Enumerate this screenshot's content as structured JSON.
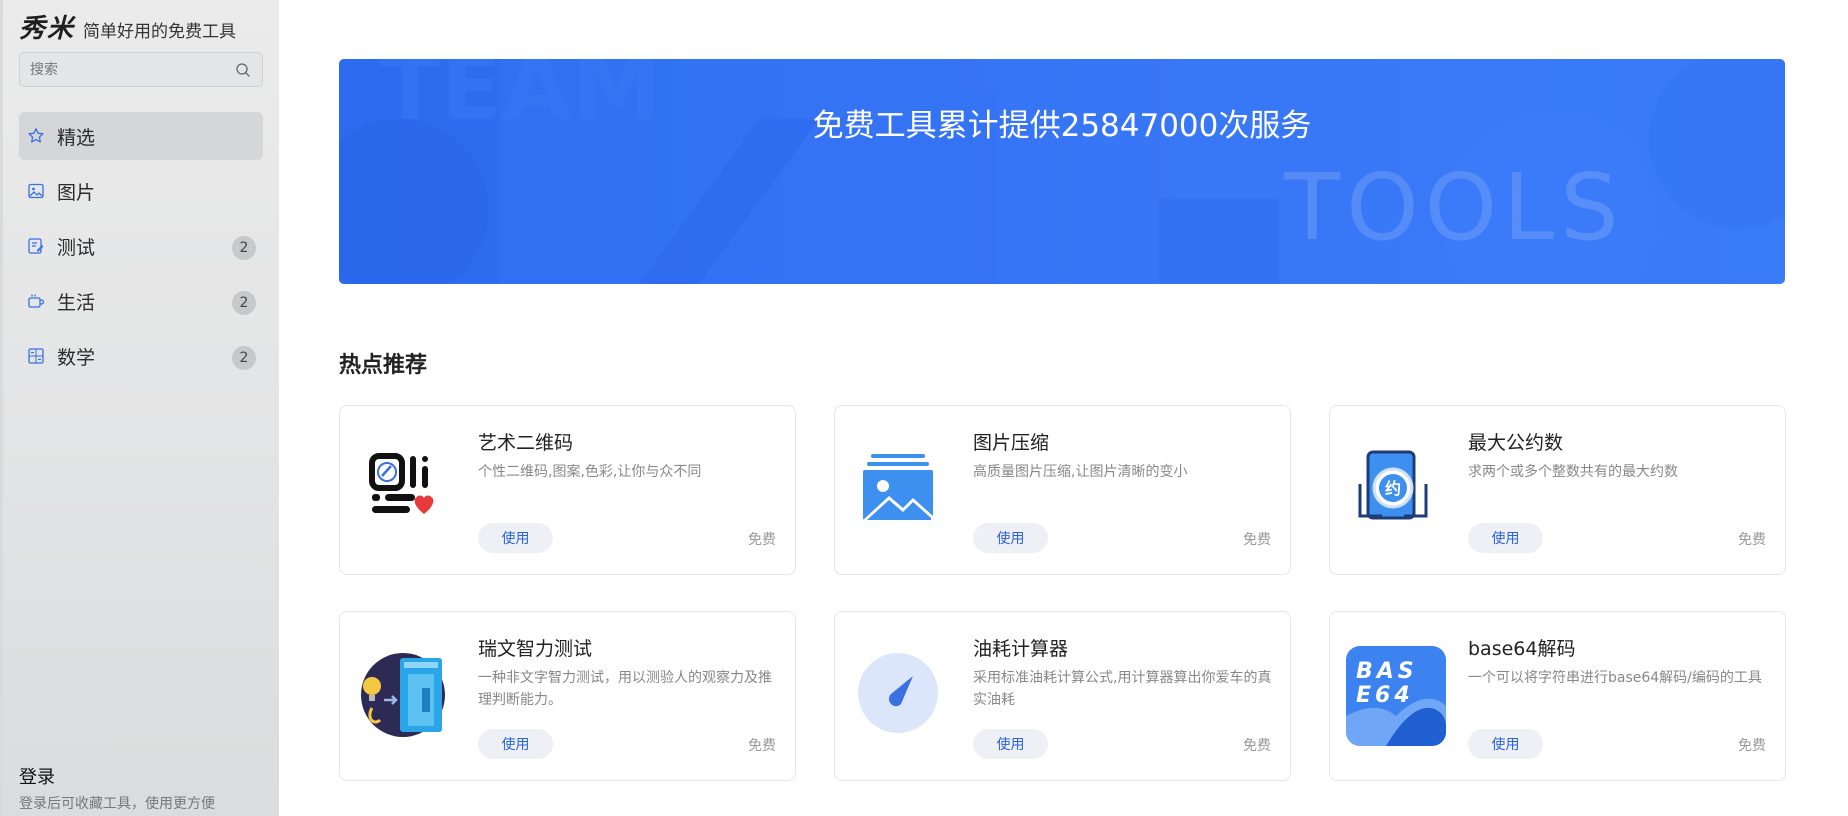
{
  "brand": {
    "logo": "秀米",
    "slogan": "简单好用的免费工具"
  },
  "search": {
    "placeholder": "搜索"
  },
  "sidebar": {
    "items": [
      {
        "label": "精选",
        "icon": "star-icon",
        "badge": ""
      },
      {
        "label": "图片",
        "icon": "image-icon",
        "badge": ""
      },
      {
        "label": "测试",
        "icon": "edit-doc-icon",
        "badge": "2"
      },
      {
        "label": "生活",
        "icon": "cup-icon",
        "badge": "2"
      },
      {
        "label": "数学",
        "icon": "calculator-icon",
        "badge": "2"
      }
    ]
  },
  "login": {
    "title": "登录",
    "hint": "登录后可收藏工具，使用更方便"
  },
  "banner": {
    "text": "免费工具累计提供25847000次服务",
    "deco_words": [
      "TEAM",
      "TOOLS"
    ]
  },
  "section": {
    "title": "热点推荐"
  },
  "cards": [
    {
      "title": "艺术二维码",
      "desc": "个性二维码,图案,色彩,让你与众不同",
      "use": "使用",
      "free": "免费",
      "icon": "art-qrcode-icon"
    },
    {
      "title": "图片压缩",
      "desc": "高质量图片压缩,让图片清晰的变小",
      "use": "使用",
      "free": "免费",
      "icon": "image-compress-icon"
    },
    {
      "title": "最大公约数",
      "desc": "求两个或多个整数共有的最大约数",
      "use": "使用",
      "free": "免费",
      "icon": "gcd-icon",
      "icon_text": "约"
    },
    {
      "title": "瑞文智力测试",
      "desc": "一种非文字智力测试，用以测验人的观察力及推理判断能力。",
      "use": "使用",
      "free": "免费",
      "icon": "raven-test-icon"
    },
    {
      "title": "油耗计算器",
      "desc": "采用标准油耗计算公式,用计算器算出你爱车的真实油耗",
      "use": "使用",
      "free": "免费",
      "icon": "fuel-gauge-icon"
    },
    {
      "title": "base64解码",
      "desc": "一个可以将字符串进行base64解码/编码的工具",
      "use": "使用",
      "free": "免费",
      "icon": "base64-icon",
      "icon_text": [
        "BAS",
        "E64"
      ]
    }
  ],
  "colors": {
    "accent": "#2f6ef2",
    "button_text": "#2a63d9",
    "sidebar_bg": "#e4e5e6"
  }
}
